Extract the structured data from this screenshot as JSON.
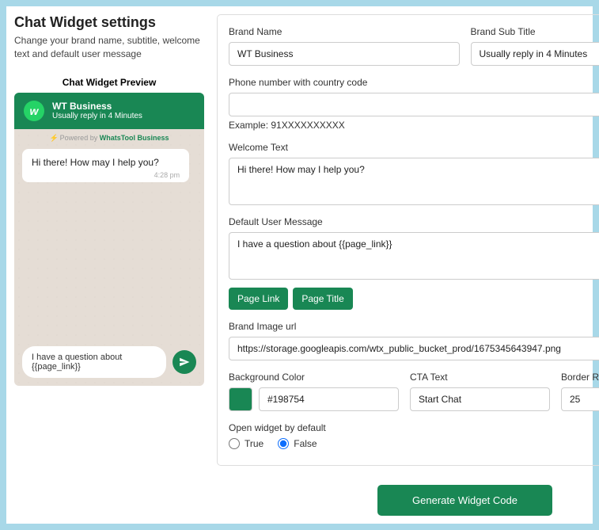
{
  "header": {
    "title": "Chat Widget settings",
    "subtitle": "Change your brand name, subtitle, welcome text and default user message"
  },
  "preview": {
    "title": "Chat Widget Preview",
    "brand_name": "WT Business",
    "brand_sub": "Usually reply in 4 Minutes",
    "powered_prefix": "Powered by ",
    "powered_brand": "WhatsTool Business",
    "bubble_text": "Hi there! How may I help you?",
    "bubble_time": "4:28 pm",
    "input_text": "I have a question about {{page_link}}"
  },
  "form": {
    "brand_name_label": "Brand Name",
    "brand_name_value": "WT Business",
    "brand_sub_label": "Brand Sub Title",
    "brand_sub_value": "Usually reply in 4 Minutes",
    "phone_label": "Phone number with country code",
    "phone_value": "",
    "phone_hint": "Example: 91XXXXXXXXXX",
    "welcome_label": "Welcome Text",
    "welcome_value": "Hi there! How may I help you?",
    "default_msg_label": "Default User Message",
    "default_msg_value": "I have a question about {{page_link}}",
    "page_link_btn": "Page Link",
    "page_title_btn": "Page Title",
    "brand_img_label": "Brand Image url",
    "brand_img_value": "https://storage.googleapis.com/wtx_public_bucket_prod/1675345643947.png",
    "bg_label": "Background Color",
    "bg_value": "#198754",
    "cta_label": "CTA Text",
    "cta_value": "Start Chat",
    "radius_label": "Border Radius(px)",
    "radius_value": "25",
    "open_default_label": "Open widget by default",
    "radio_true": "True",
    "radio_false": "False",
    "generate_btn": "Generate Widget Code"
  }
}
